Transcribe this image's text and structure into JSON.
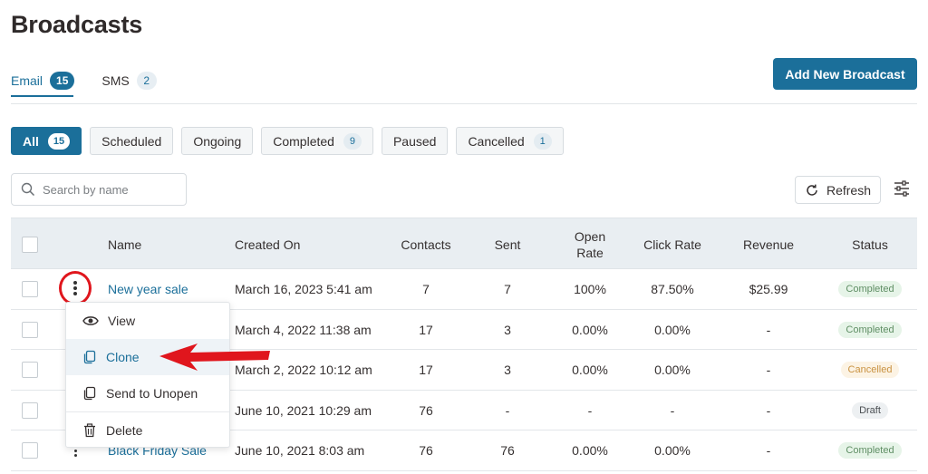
{
  "page": {
    "title": "Broadcasts"
  },
  "tabs": [
    {
      "label": "Email",
      "count": "15"
    },
    {
      "label": "SMS",
      "count": "2"
    }
  ],
  "actions": {
    "add_label": "Add New Broadcast",
    "refresh_label": "Refresh"
  },
  "filters": [
    {
      "label": "All",
      "count": "15"
    },
    {
      "label": "Scheduled"
    },
    {
      "label": "Ongoing"
    },
    {
      "label": "Completed",
      "count": "9"
    },
    {
      "label": "Paused"
    },
    {
      "label": "Cancelled",
      "count": "1"
    }
  ],
  "search": {
    "placeholder": "Search by name"
  },
  "table": {
    "headers": {
      "name": "Name",
      "created": "Created On",
      "contacts": "Contacts",
      "sent": "Sent",
      "open_rate_1": "Open",
      "open_rate_2": "Rate",
      "click_rate": "Click Rate",
      "revenue": "Revenue",
      "status": "Status"
    },
    "rows": [
      {
        "name": "New year sale",
        "created": "March 16, 2023 5:41 am",
        "contacts": "7",
        "sent": "7",
        "open": "100%",
        "click": "87.50%",
        "revenue": "$25.99",
        "status": "Completed"
      },
      {
        "name": "",
        "created": "March 4, 2022 11:38 am",
        "contacts": "17",
        "sent": "3",
        "open": "0.00%",
        "click": "0.00%",
        "revenue": "-",
        "status": "Completed"
      },
      {
        "name": "",
        "created": "March 2, 2022 10:12 am",
        "contacts": "17",
        "sent": "3",
        "open": "0.00%",
        "click": "0.00%",
        "revenue": "-",
        "status": "Cancelled"
      },
      {
        "name": "",
        "created": "June 10, 2021 10:29 am",
        "contacts": "76",
        "sent": "-",
        "open": "-",
        "click": "-",
        "revenue": "-",
        "status": "Draft"
      },
      {
        "name": "Black Friday Sale",
        "created": "June 10, 2021 8:03 am",
        "contacts": "76",
        "sent": "76",
        "open": "0.00%",
        "click": "0.00%",
        "revenue": "-",
        "status": "Completed"
      }
    ]
  },
  "row_menu": {
    "items": [
      {
        "label": "View",
        "icon": "eye-icon"
      },
      {
        "label": "Clone",
        "icon": "copy-icon"
      },
      {
        "label": "Send to Unopen",
        "icon": "copy-icon"
      },
      {
        "label": "Delete",
        "icon": "trash-icon"
      }
    ]
  },
  "colors": {
    "accent": "#1b6f9a",
    "annotation": "#e0161d",
    "completed_bg": "#e6f4e8",
    "cancelled_bg": "#fcf3e4"
  }
}
